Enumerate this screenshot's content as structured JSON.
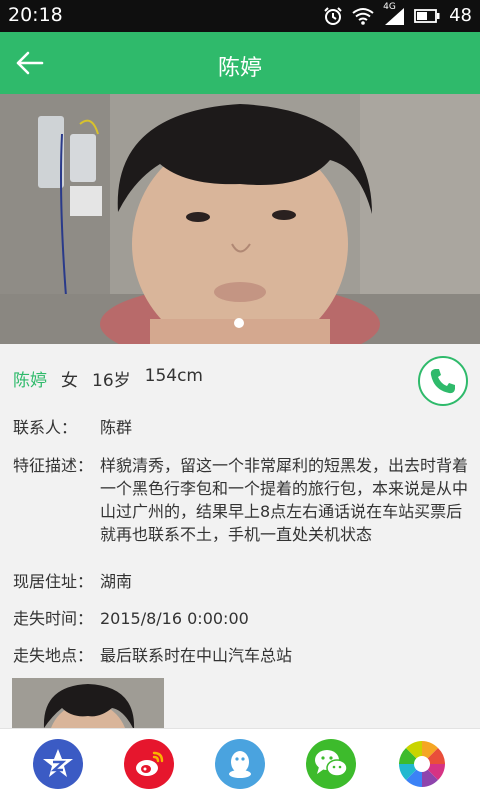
{
  "status": {
    "time": "20:18",
    "network": "4G",
    "battery": "48"
  },
  "header": {
    "title": "陈婷"
  },
  "person": {
    "name": "陈婷",
    "gender": "女",
    "age": "16岁",
    "height": "154cm"
  },
  "details": {
    "contact_label": "联系人：",
    "contact_value": "陈群",
    "features_label": "特征描述：",
    "features_value": "样貌清秀，留这一个非常犀利的短黑发，出去时背着一个黑色行李包和一个提着的旅行包，本来说是从中山过广州的，结果早上8点左右通话说在车站买票后就再也联系不土，手机一直处关机状态",
    "address_label": "现居住址：",
    "address_value": "湖南",
    "lost_time_label": "走失时间：",
    "lost_time_value": "2015/8/16 0:00:00",
    "lost_place_label": "走失地点：",
    "lost_place_value": "最后联系时在中山汽车总站"
  },
  "photo_carousel": {
    "page_count": 1,
    "current_page": 1
  },
  "share_buttons": [
    {
      "name": "qzone-icon",
      "color": "#3b5bc4"
    },
    {
      "name": "weibo-icon",
      "color": "#e6162d"
    },
    {
      "name": "qq-icon",
      "color": "#4aa3df"
    },
    {
      "name": "wechat-icon",
      "color": "#3dbb2c"
    },
    {
      "name": "moments-icon",
      "color": "#f5a623"
    }
  ],
  "colors": {
    "accent": "#2fba6b",
    "status_bar": "#0f0f0f",
    "background": "#f2f2f2"
  }
}
